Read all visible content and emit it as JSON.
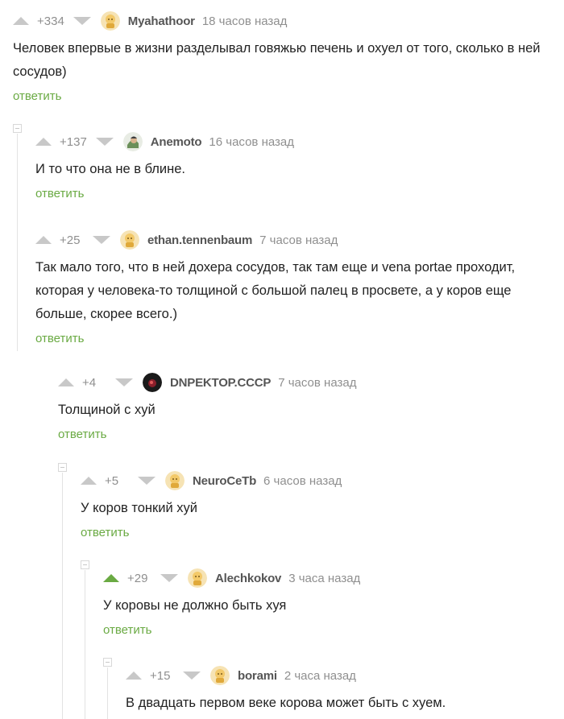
{
  "reply_label": "ответить",
  "comments": [
    {
      "rating": "+334",
      "author": "Myahathoor",
      "time": "18 часов назад",
      "text": "Человек впервые в жизни разделывал говяжью печень и охуел от того, сколько в ней сосудов)",
      "avatar": "default-avatar-icon"
    },
    {
      "rating": "+137",
      "author": "Anemoto",
      "time": "16 часов назад",
      "text": "И то что она не в блине.",
      "avatar": "user-photo-avatar"
    },
    {
      "rating": "+25",
      "author": "ethan.tennenbaum",
      "time": "7 часов назад",
      "text": "Так мало того, что в ней дохера сосудов, так там еще и vena portae проходит, которая у человека-то толщиной с большой палец в просвете, а у коров еще больше, скорее всего.)",
      "avatar": "default-avatar-icon"
    },
    {
      "rating": "+4",
      "author": "DNPEKTOP.CCCP",
      "time": "7 часов назад",
      "text": "Толщиной с хуй",
      "avatar": "dark-photo-avatar"
    },
    {
      "rating": "+5",
      "author": "NeuroCeTb",
      "time": "6 часов назад",
      "text": "У коров тонкий хуй",
      "avatar": "default-avatar-icon"
    },
    {
      "rating": "+29",
      "author": "Alechkokov",
      "time": "3 часа назад",
      "text": "У коровы не должно быть хуя",
      "avatar": "default-avatar-icon",
      "upvoted": true
    },
    {
      "rating": "+15",
      "author": "borami",
      "time": "2 часа назад",
      "text": "В двадцать первом веке корова может быть с хуем.",
      "avatar": "default-avatar-icon"
    }
  ],
  "colors": {
    "accent": "#6aaa43",
    "muted": "#8f8f8f",
    "vote_inactive": "#c8c8c8"
  }
}
